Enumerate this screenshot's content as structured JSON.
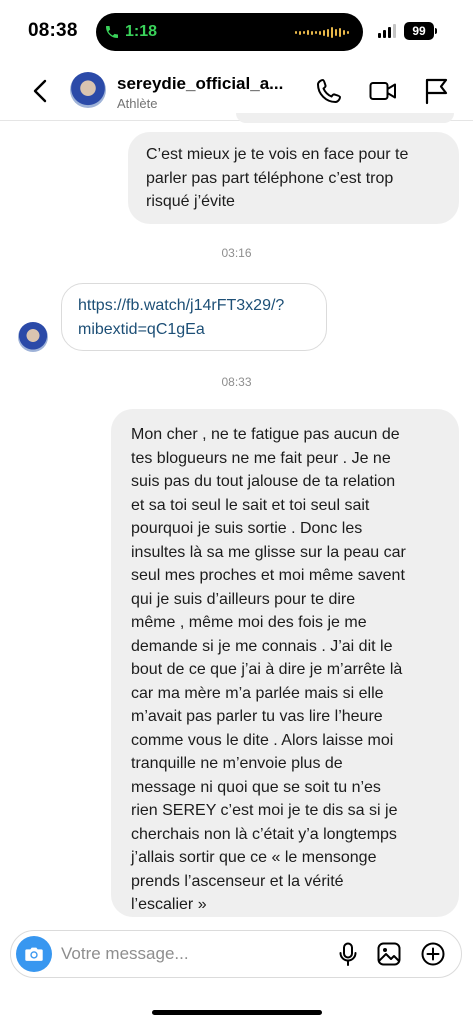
{
  "status_bar": {
    "time": "08:38",
    "call_duration": "1:18",
    "battery": "99"
  },
  "header": {
    "username": "sereydie_official_a...",
    "subtitle": "Athlète"
  },
  "messages": {
    "m1": "C’est mieux je te vois en face pour te\nparler pas part téléphone c’est trop\nrisqué j’évite",
    "ts1": "03:16",
    "link": "https://fb.watch/j14rFT3x29/?\nmibextid=qC1gEa",
    "ts2": "08:33",
    "m2": "Mon cher , ne te fatigue pas aucun de\ntes blogueurs ne me fait peur . Je ne\nsuis pas du tout jalouse de ta relation\net sa toi seul le sait et toi seul sait\npourquoi je suis sortie . Donc les\ninsultes là sa me glisse sur la peau car\nseul mes proches et moi même savent\nqui je suis d’ailleurs pour te dire\nmême , même moi des fois je me\ndemande si je me connais . J’ai dit le\nbout de ce que j’ai à dire je m’arrête là\ncar ma mère m’a parlée mais si elle\nm’avait pas parler tu vas lire l’heure\ncomme vous le dite . Alors laisse moi\ntranquille ne m’envoie plus de\nmessage ni quoi que se soit tu n’es\nrien SEREY c’est moi je te dis sa si je\ncherchais non là c’était y’a longtemps\nj’allais sortir que ce « le mensonge\nprends l’ascenseur et la vérité\nl’escalier »"
  },
  "composer": {
    "placeholder": "Votre message..."
  },
  "icons": {
    "back": "chevron-left-icon",
    "call": "phone-icon",
    "video": "video-camera-icon",
    "report": "flag-icon",
    "camera": "camera-icon",
    "mic": "microphone-icon",
    "gallery": "image-icon",
    "more": "plus-circle-icon"
  },
  "colors": {
    "bubble": "#efefef",
    "link": "#1d4f76",
    "camera_button": "#3897f0",
    "call_green": "#3ad25a"
  }
}
